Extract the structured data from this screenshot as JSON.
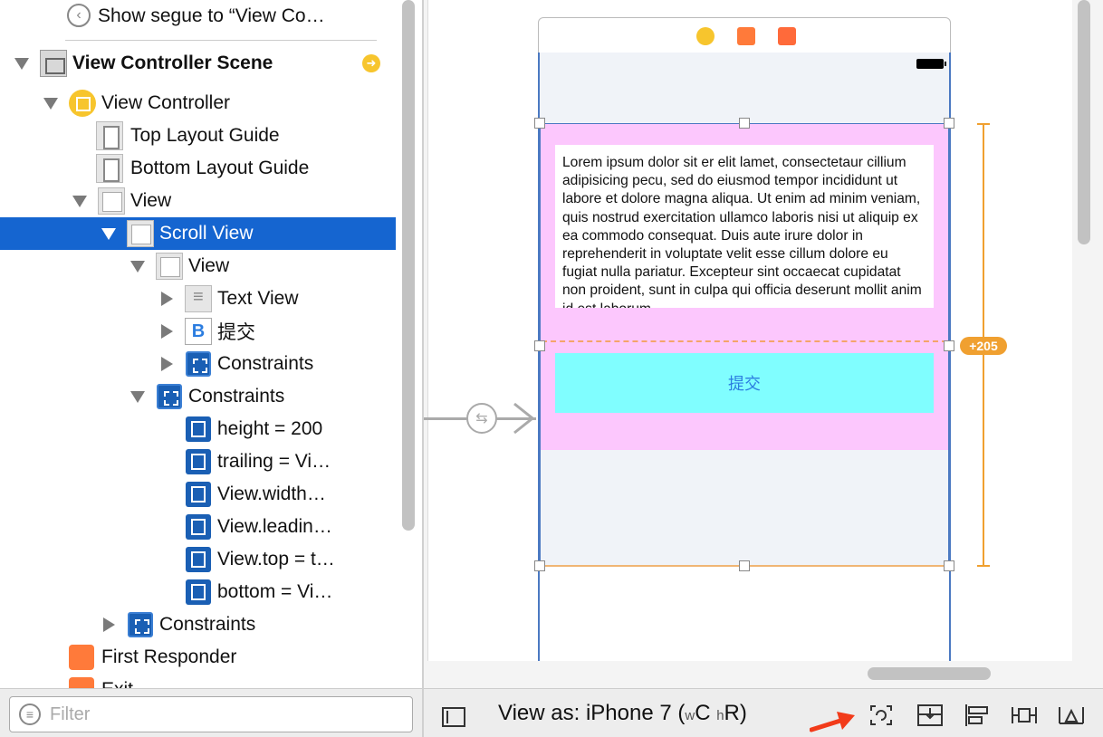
{
  "outline": {
    "rows": [
      {
        "label": "Show segue to “View Co…",
        "icon": "segue-back-icon"
      },
      {
        "label": "View Controller Scene",
        "icon": "scene-icon"
      },
      {
        "label": "View Controller",
        "icon": "view-controller-icon"
      },
      {
        "label": "Top Layout Guide",
        "icon": "layout-guide-icon"
      },
      {
        "label": "Bottom Layout Guide",
        "icon": "layout-guide-icon"
      },
      {
        "label": "View",
        "icon": "view-icon"
      },
      {
        "label": "Scroll View",
        "icon": "scroll-view-icon"
      },
      {
        "label": "View",
        "icon": "view-icon"
      },
      {
        "label": "Text View",
        "icon": "text-view-icon"
      },
      {
        "label": "提交",
        "icon": "button-icon",
        "icon_glyph": "B"
      },
      {
        "label": "Constraints",
        "icon": "constraints-icon"
      },
      {
        "label": "Constraints",
        "icon": "constraints-icon"
      },
      {
        "label": "height = 200",
        "icon": "height-constraint-icon"
      },
      {
        "label": "trailing = Vi…",
        "icon": "trailing-constraint-icon"
      },
      {
        "label": "View.width…",
        "icon": "width-constraint-icon"
      },
      {
        "label": "View.leadin…",
        "icon": "leading-constraint-icon"
      },
      {
        "label": "View.top = t…",
        "icon": "top-constraint-icon"
      },
      {
        "label": "bottom = Vi…",
        "icon": "bottom-constraint-icon"
      },
      {
        "label": "Constraints",
        "icon": "constraints-icon"
      },
      {
        "label": "First Responder",
        "icon": "first-responder-icon"
      },
      {
        "label": "Exit",
        "icon": "exit-icon"
      }
    ],
    "selected": "Scroll View",
    "warning_icon": "warning-icon"
  },
  "filter": {
    "placeholder": "Filter"
  },
  "canvas": {
    "text_view_content": "Lorem ipsum dolor sit er elit lamet, consectetaur cillium adipisicing pecu, sed do eiusmod tempor incididunt ut labore et dolore magna aliqua. Ut enim ad minim veniam, quis nostrud exercitation ullamco laboris nisi ut aliquip ex ea commodo consequat. Duis aute irure dolor in reprehenderit in voluptate velit esse cillum dolore eu fugiat nulla pariatur. Excepteur sint occaecat cupidatat non proident, sunt in culpa qui officia deserunt mollit anim id est laborum.",
    "button_label": "提交",
    "ambiguity_badge": "+205",
    "colors": {
      "content_view": "#fcc7fd",
      "button_bg": "#80feff",
      "button_text": "#2b7de0",
      "selection": "#1565d0",
      "constraint_orange": "#f0a030",
      "frame_blue": "#4b79c2"
    }
  },
  "toolbar": {
    "view_as_prefix": "View as: iPhone 7 (",
    "w_label": "w",
    "c_label": "C",
    "h_label": "h",
    "r_label": "R",
    "view_as_suffix": ")",
    "icons": [
      "update-frames-icon",
      "embed-in-stack-icon",
      "align-icon",
      "pin-icon",
      "resolve-issues-icon"
    ]
  }
}
